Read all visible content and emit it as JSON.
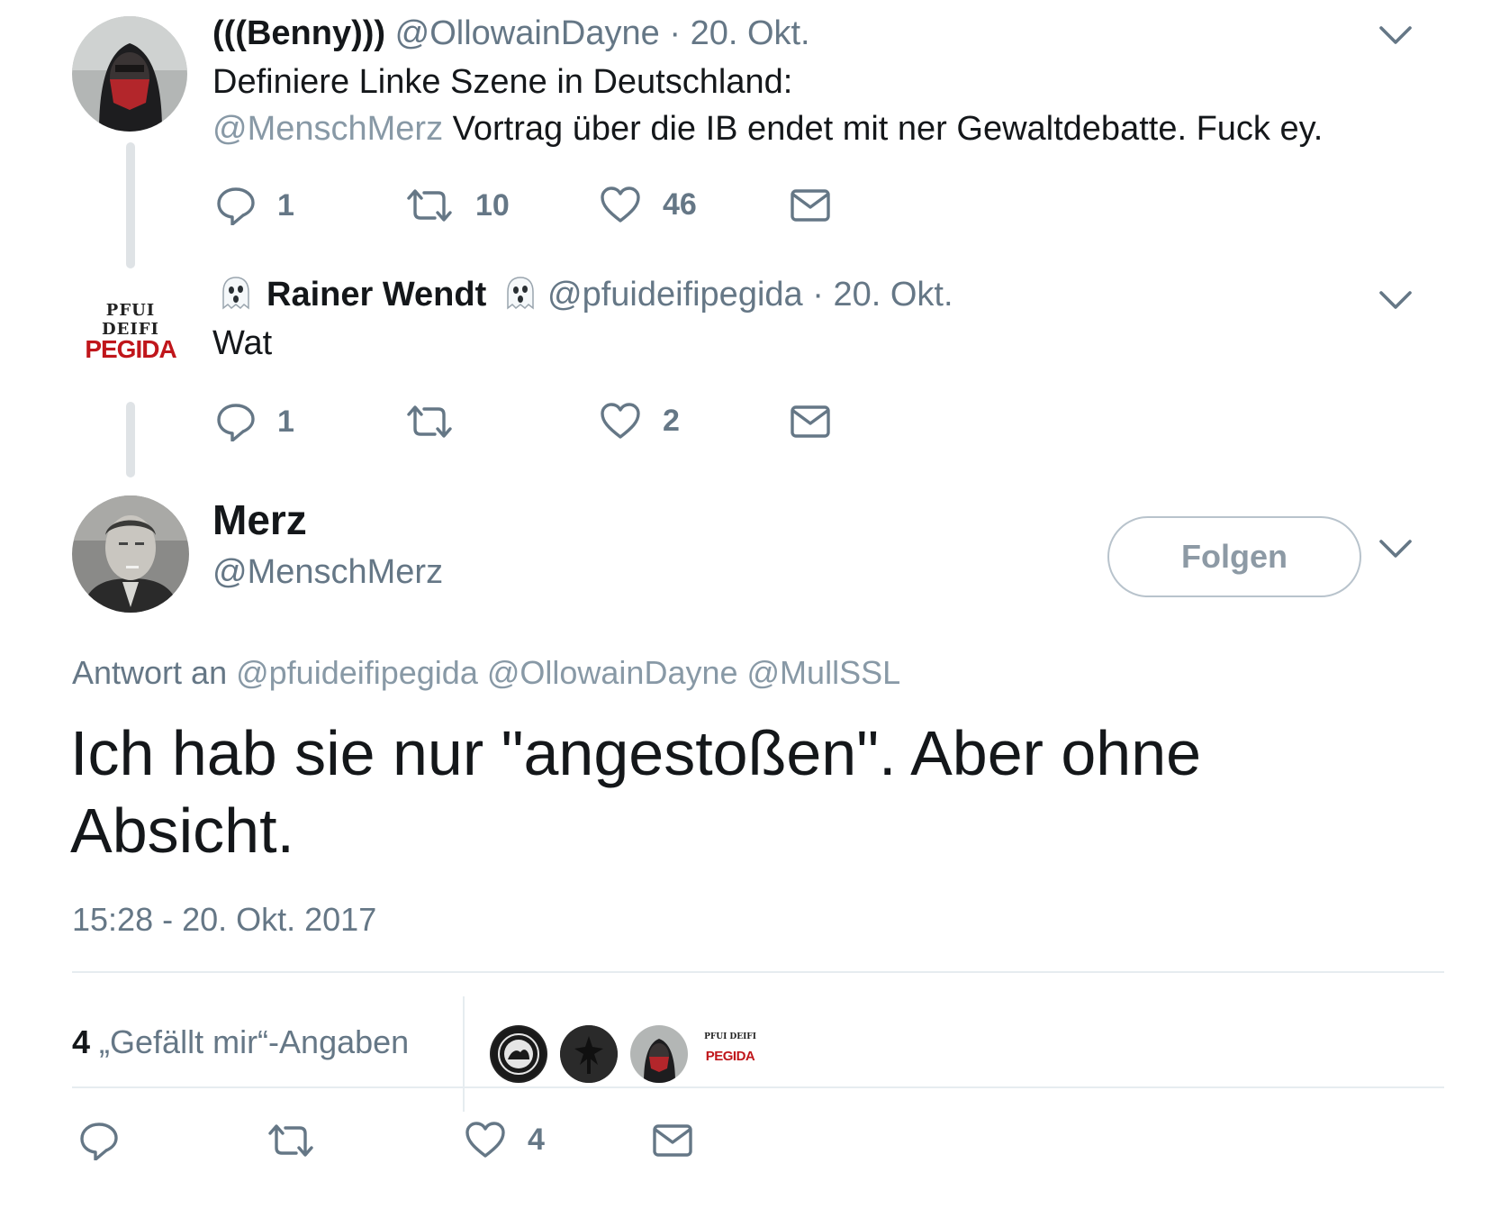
{
  "tweets": [
    {
      "display_name": "(((Benny)))",
      "handle": "@OllowainDayne",
      "sep": "·",
      "date": "20. Okt.",
      "text_line1": "Definiere Linke Szene in Deutschland:",
      "mention": "@MenschMerz",
      "text_line2": "Vortrag über die IB endet mit ner Gewaltdebatte. Fuck ey.",
      "replies": "1",
      "retweets": "10",
      "likes": "46"
    },
    {
      "display_name": "Rainer Wendt",
      "handle": "@pfuideifipegida",
      "sep": "·",
      "date": "20. Okt.",
      "text": "Wat",
      "replies": "1",
      "retweets": "",
      "likes": "2",
      "avatar_top": "PFUI DEIFI",
      "avatar_bottom": "PEGIDA"
    }
  ],
  "main": {
    "display_name": "Merz",
    "handle": "@MenschMerz",
    "follow_label": "Folgen",
    "reply_to_label": "Antwort an",
    "reply_to_handles": "@pfuideifipegida @OllowainDayne @MullSSL",
    "text_line1": "Ich hab sie nur \"angestoßen\". Aber ohne",
    "text_line2": "Absicht.",
    "timestamp": "15:28 - 20. Okt. 2017",
    "likes_count": "4",
    "likes_label": "„Gefällt mir“-Angaben",
    "liker_avatar_4_top": "PFUI DEIFI",
    "liker_avatar_4_bottom": "PEGIDA",
    "actions": {
      "replies": "",
      "retweets": "",
      "likes": "4"
    }
  },
  "icons": [
    "reply-icon",
    "retweet-icon",
    "like-icon",
    "dm-icon",
    "chevron-down-icon",
    "ghost-emoji-icon"
  ],
  "colors": {
    "text": "#14171a",
    "secondary": "#657786",
    "mention": "#8899a6",
    "pegida_red": "#c0161b"
  }
}
